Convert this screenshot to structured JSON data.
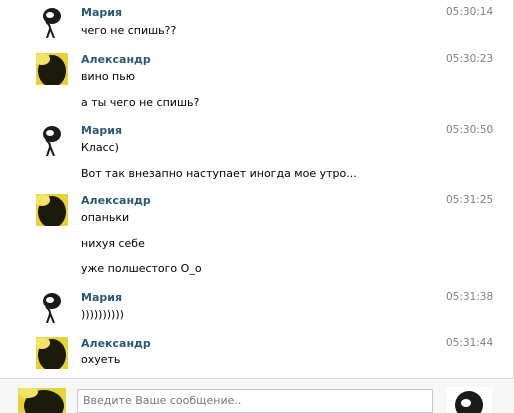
{
  "messages": [
    {
      "author": "Мария",
      "avatar": "maria",
      "time": "05:30:14",
      "lines": [
        "чего не спишь??"
      ]
    },
    {
      "author": "Александр",
      "avatar": "alexander",
      "time": "05:30:23",
      "lines": [
        "вино пью",
        "а ты чего не спишь?"
      ]
    },
    {
      "author": "Мария",
      "avatar": "maria",
      "time": "05:30:50",
      "lines": [
        "Класс)",
        "Вот так внезапно наступает иногда мое утро..."
      ]
    },
    {
      "author": "Александр",
      "avatar": "alexander",
      "time": "05:31:25",
      "lines": [
        "опаньки",
        "нихуя себе",
        "уже полшестого О_о"
      ]
    },
    {
      "author": "Мария",
      "avatar": "maria",
      "time": "05:31:38",
      "lines": [
        "))))))))))"
      ]
    },
    {
      "author": "Александр",
      "avatar": "alexander",
      "time": "05:31:44",
      "lines": [
        "охуеть"
      ]
    }
  ],
  "composer": {
    "placeholder": "Введите Ваше сообщение.."
  },
  "colors": {
    "author": "#2b587a",
    "time": "#808080",
    "border": "#dcdcdc"
  }
}
